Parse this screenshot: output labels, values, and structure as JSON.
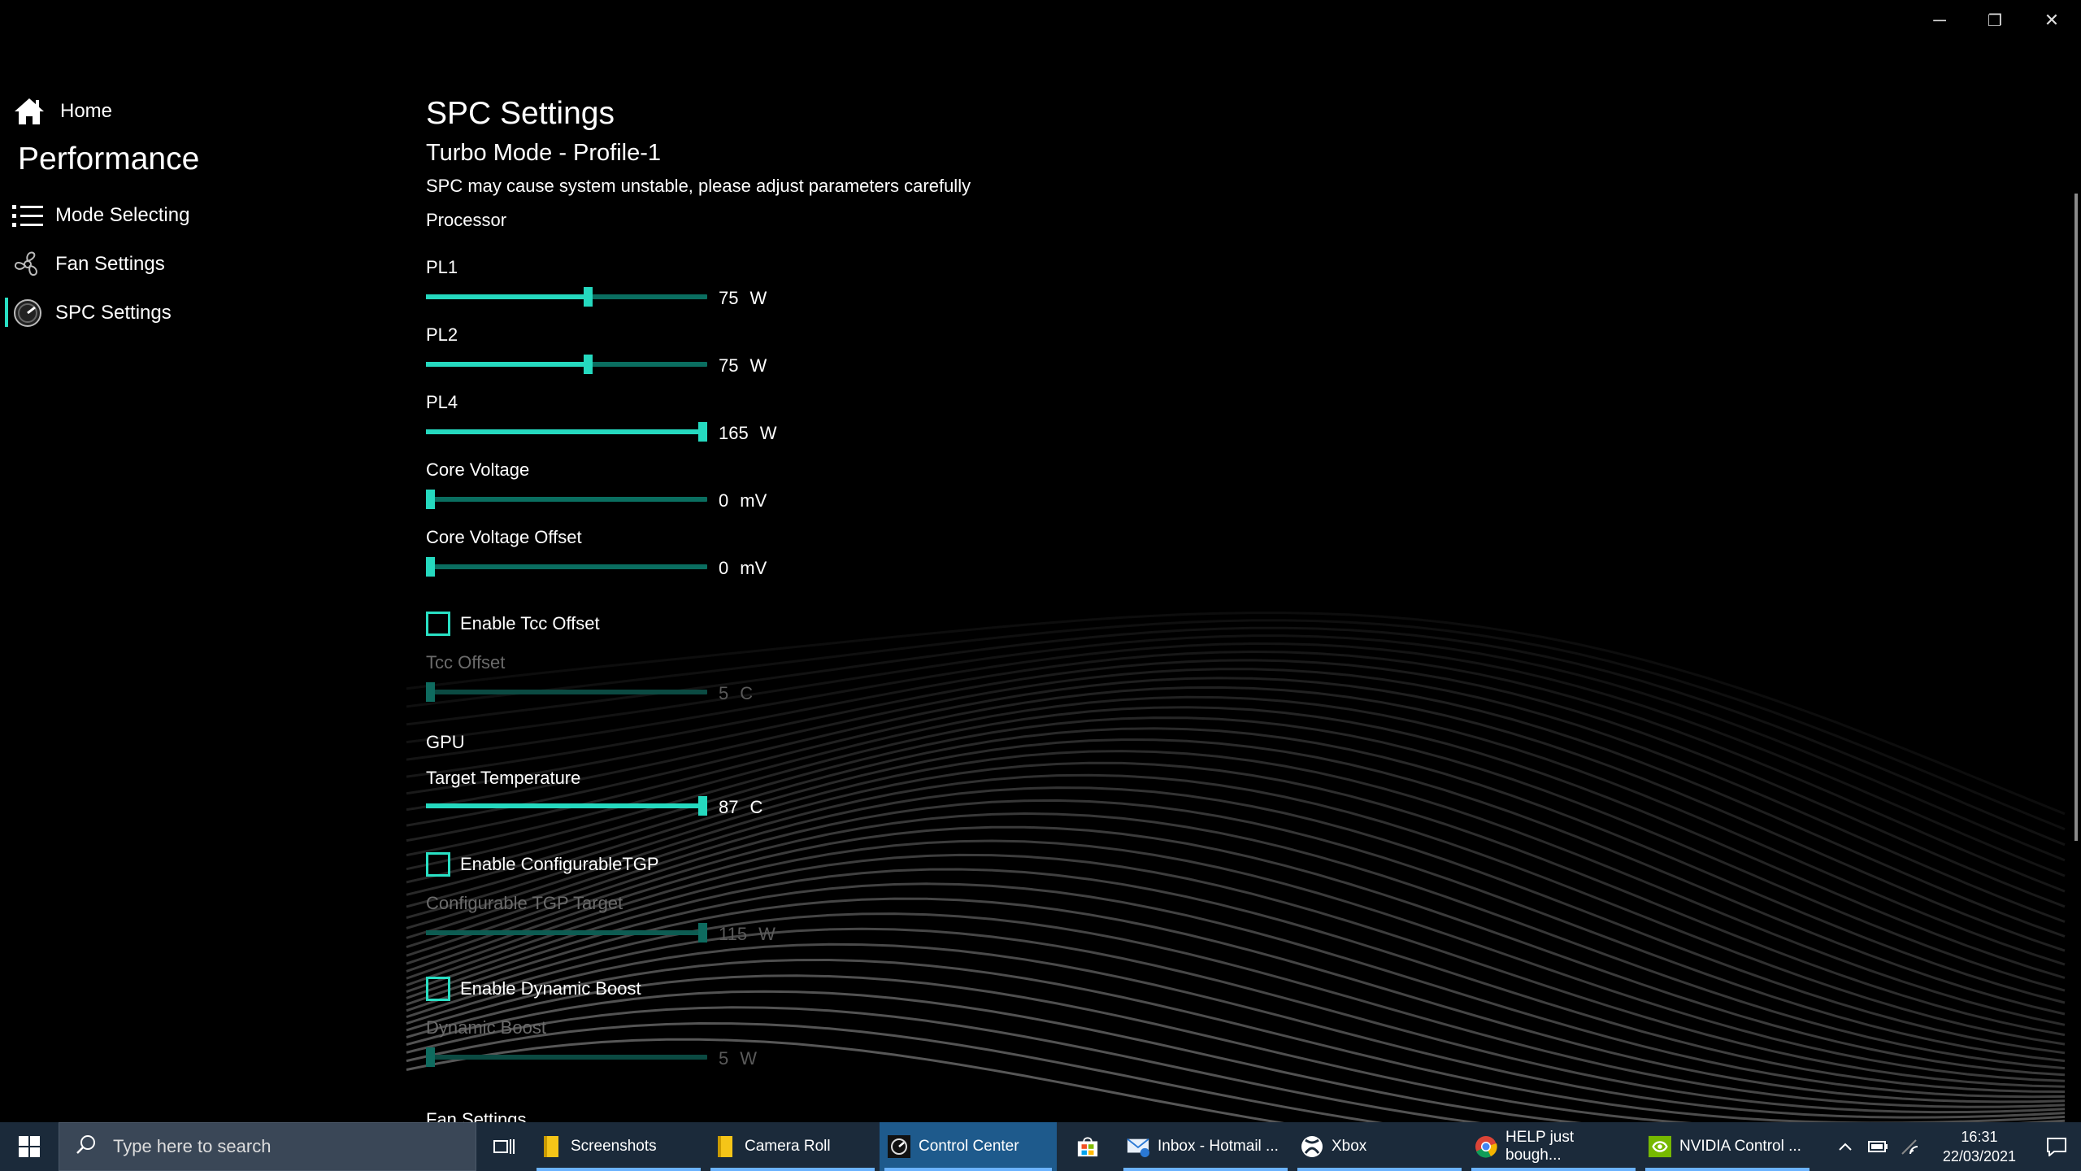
{
  "window": {
    "minimize": "─",
    "restore": "❐",
    "close": "✕"
  },
  "sidebar": {
    "home": "Home",
    "section": "Performance",
    "items": [
      {
        "label": "Mode Selecting",
        "icon": "list-icon"
      },
      {
        "label": "Fan Settings",
        "icon": "fan-icon"
      },
      {
        "label": "SPC Settings",
        "icon": "gauge-icon",
        "active": true
      }
    ]
  },
  "main": {
    "title": "SPC Settings",
    "subtitle": "Turbo Mode - Profile-1",
    "warning": "SPC may cause system unstable, please adjust parameters carefully",
    "processor_heading": "Processor",
    "gpu_heading": "GPU",
    "next_heading": "Fan Settings",
    "sliders": {
      "pl1": {
        "label": "PL1",
        "value": "75",
        "unit": "W",
        "fraction": 0.58
      },
      "pl2": {
        "label": "PL2",
        "value": "75",
        "unit": "W",
        "fraction": 0.58
      },
      "pl4": {
        "label": "PL4",
        "value": "165",
        "unit": "W",
        "fraction": 1.0
      },
      "core_voltage": {
        "label": "Core Voltage",
        "value": "0",
        "unit": "mV",
        "fraction": 0.0
      },
      "core_voltage_offset": {
        "label": "Core Voltage Offset",
        "value": "0",
        "unit": "mV",
        "fraction": 0.0
      },
      "tcc_offset": {
        "label": "Tcc Offset",
        "value": "5",
        "unit": "C",
        "fraction": 0.0
      },
      "target_temperature": {
        "label": "Target Temperature",
        "value": "87",
        "unit": "C",
        "fraction": 1.0
      },
      "configurable_tgp": {
        "label": "Configurable TGP Target",
        "value": "115",
        "unit": "W",
        "fraction": 1.0
      },
      "dynamic_boost": {
        "label": "Dynamic Boost",
        "value": "5",
        "unit": "W",
        "fraction": 0.0
      }
    },
    "checkboxes": {
      "tcc": "Enable Tcc Offset",
      "tgp": "Enable ConfigurableTGP",
      "boost": "Enable Dynamic Boost"
    }
  },
  "taskbar": {
    "search_placeholder": "Type here to search",
    "apps": [
      {
        "label": "Screenshots",
        "icon": "folder-icon"
      },
      {
        "label": "Camera Roll",
        "icon": "folder-icon"
      },
      {
        "label": "Control Center",
        "icon": "control-center-icon"
      },
      {
        "label": "",
        "icon": "store-icon"
      },
      {
        "label": "Inbox - Hotmail ...",
        "icon": "mail-icon"
      },
      {
        "label": "Xbox",
        "icon": "xbox-icon"
      },
      {
        "label": "HELP just bough...",
        "icon": "chrome-icon"
      },
      {
        "label": "NVIDIA Control ...",
        "icon": "nvidia-icon"
      }
    ],
    "time": "16:31",
    "date": "22/03/2021"
  }
}
